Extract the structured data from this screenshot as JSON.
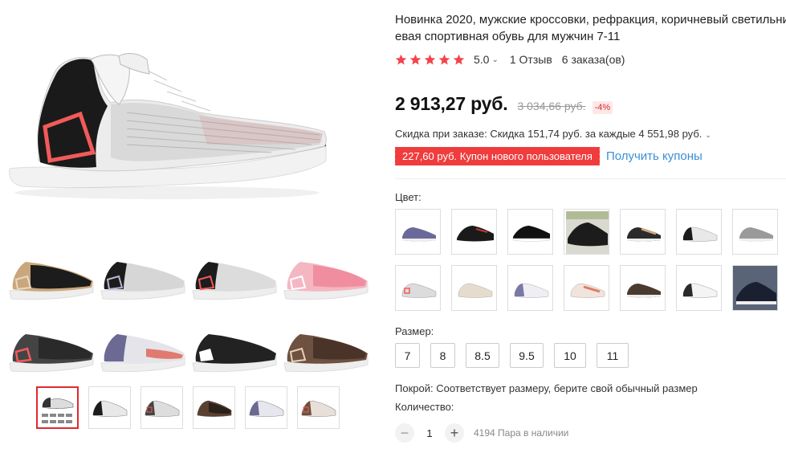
{
  "product": {
    "title_line1": "Новинка 2020, мужские кроссовки, рефракция, коричневый светильни",
    "title_line2": "евая спортивная обувь для мужчин 7-11",
    "rating": "5.0",
    "reviews": "1 Отзыв",
    "orders": "6 заказа(ов)"
  },
  "price": {
    "current": "2 913,27 руб.",
    "old": "3 034,66 руб.",
    "discount": "-4%"
  },
  "store_discount": "Скидка при заказе: Скидка 151,74 руб. за каждые 4 551,98 руб.",
  "coupon": {
    "badge": "227,60 руб. Купон нового пользователя",
    "link": "Получить купоны"
  },
  "colors": {
    "label": "Цвет:",
    "count": 14
  },
  "sizes": {
    "label": "Размер:",
    "options": [
      "7",
      "8",
      "8.5",
      "9.5",
      "10",
      "11"
    ]
  },
  "fit_note": "Покрой: Соответствует размеру, берите свой обычный размер",
  "quantity": {
    "label": "Количество:",
    "minus": "−",
    "value": "1",
    "plus": "+",
    "stock": "4194 Пара в наличии"
  },
  "icons": {
    "star": "star-icon",
    "chevron": "chevron-down-icon"
  },
  "theme": {
    "accent": "#e0282e",
    "star": "#f5424b",
    "link": "#3a8fd6"
  }
}
